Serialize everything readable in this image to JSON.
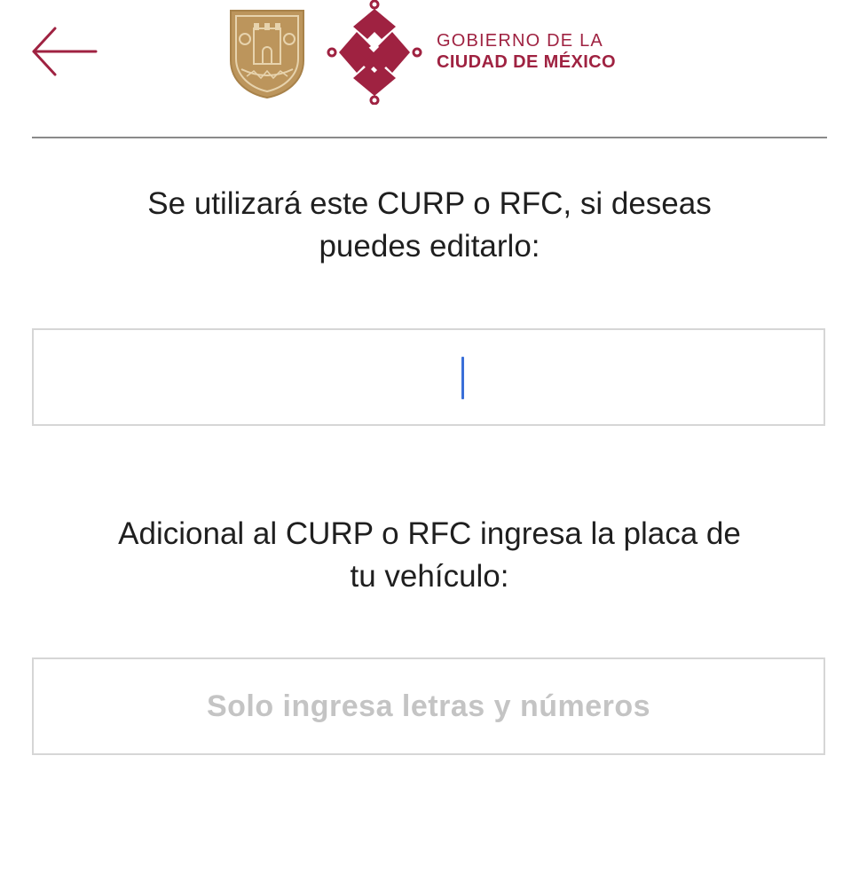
{
  "header": {
    "back_icon": "arrow-left-icon",
    "brand": {
      "line1": "GOBIERNO DE LA",
      "line2": "CIUDAD DE MÉXICO",
      "color": "#9f2241"
    },
    "shield_icon": "cdmx-coat-of-arms-icon",
    "logo_icon": "cdmx-logo-mark-icon"
  },
  "curp_section": {
    "prompt_line1": "Se utilizará este CURP o RFC, si deseas",
    "prompt_line2": "puedes editarlo:",
    "input_value": "",
    "input_placeholder": ""
  },
  "plate_section": {
    "prompt_line1": "Adicional al CURP o RFC ingresa la placa de",
    "prompt_line2": "tu vehículo:",
    "input_value": "",
    "input_placeholder": "Solo ingresa letras y números"
  },
  "colors": {
    "accent": "#9f2241",
    "gold": "#bc955c",
    "caret": "#3a6fd8",
    "border": "#d6d6d6",
    "placeholder": "#c4c4c4"
  }
}
